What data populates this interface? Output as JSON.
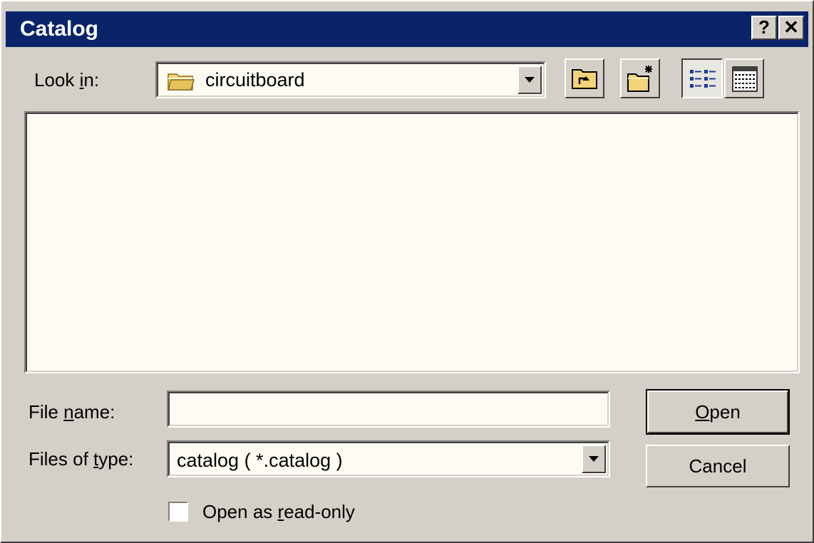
{
  "window": {
    "title": "Catalog",
    "help_button": "?",
    "close_button": "✕"
  },
  "look_in": {
    "label_pre": "Look ",
    "label_mnemonic": "i",
    "label_post": "n:",
    "value": "circuitboard",
    "icon": "folder-icon"
  },
  "toolbar": {
    "up_folder_icon": "up-folder-icon",
    "new_folder_icon": "new-folder-icon",
    "list_view_icon": "list-view-icon",
    "details_view_icon": "details-view-icon",
    "active_view": "list"
  },
  "file_list": {
    "items": []
  },
  "file_name": {
    "label_pre": "File ",
    "label_mnemonic": "n",
    "label_post": "ame:",
    "value": ""
  },
  "file_type": {
    "label_pre": "Files of ",
    "label_mnemonic": "t",
    "label_post": "ype:",
    "value": "catalog ( *.catalog )"
  },
  "buttons": {
    "open_mnemonic": "O",
    "open_rest": "pen",
    "cancel": "Cancel"
  },
  "read_only": {
    "label_pre": "Open as ",
    "label_mnemonic": "r",
    "label_post": "ead-only",
    "checked": false
  },
  "colors": {
    "title_bar": "#0a246a",
    "face": "#d4d0c8",
    "field_bg": "#fdfbf2",
    "folder": "#f2d27a"
  }
}
